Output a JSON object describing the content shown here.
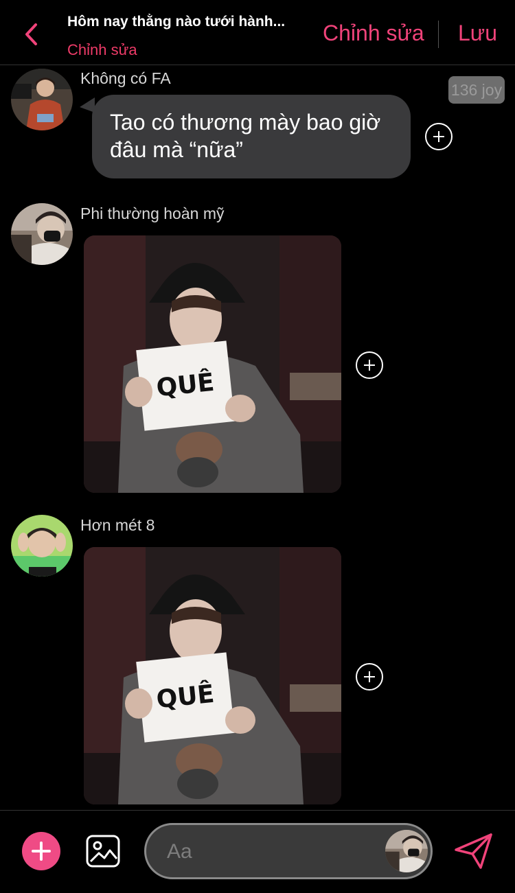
{
  "header": {
    "title": "Hôm nay thằng nào tưới hành...",
    "subtitle": "Chỉnh sửa",
    "edit_label": "Chỉnh sửa",
    "save_label": "Lưu",
    "back_icon": "chevron-left-icon"
  },
  "messages": [
    {
      "sender": "Không có FA",
      "type": "text",
      "text_line1": "Tao có thương mày bao giờ",
      "text_line2": "đâu mà “nữa”",
      "joy": "136 joy"
    },
    {
      "sender": "Phi thường hoàn mỹ",
      "type": "image",
      "image_sign_text": "QUÊ"
    },
    {
      "sender": "Hơn mét 8",
      "type": "image",
      "image_sign_text": "QUÊ"
    }
  ],
  "composer": {
    "placeholder": "Aa",
    "plus_icon": "plus-icon",
    "gallery_icon": "image-icon",
    "send_icon": "paper-plane-icon"
  },
  "colors": {
    "accent": "#f0437a",
    "background": "#000000",
    "bubble": "#3a3a3c",
    "plus_button": "#ef4b85"
  }
}
